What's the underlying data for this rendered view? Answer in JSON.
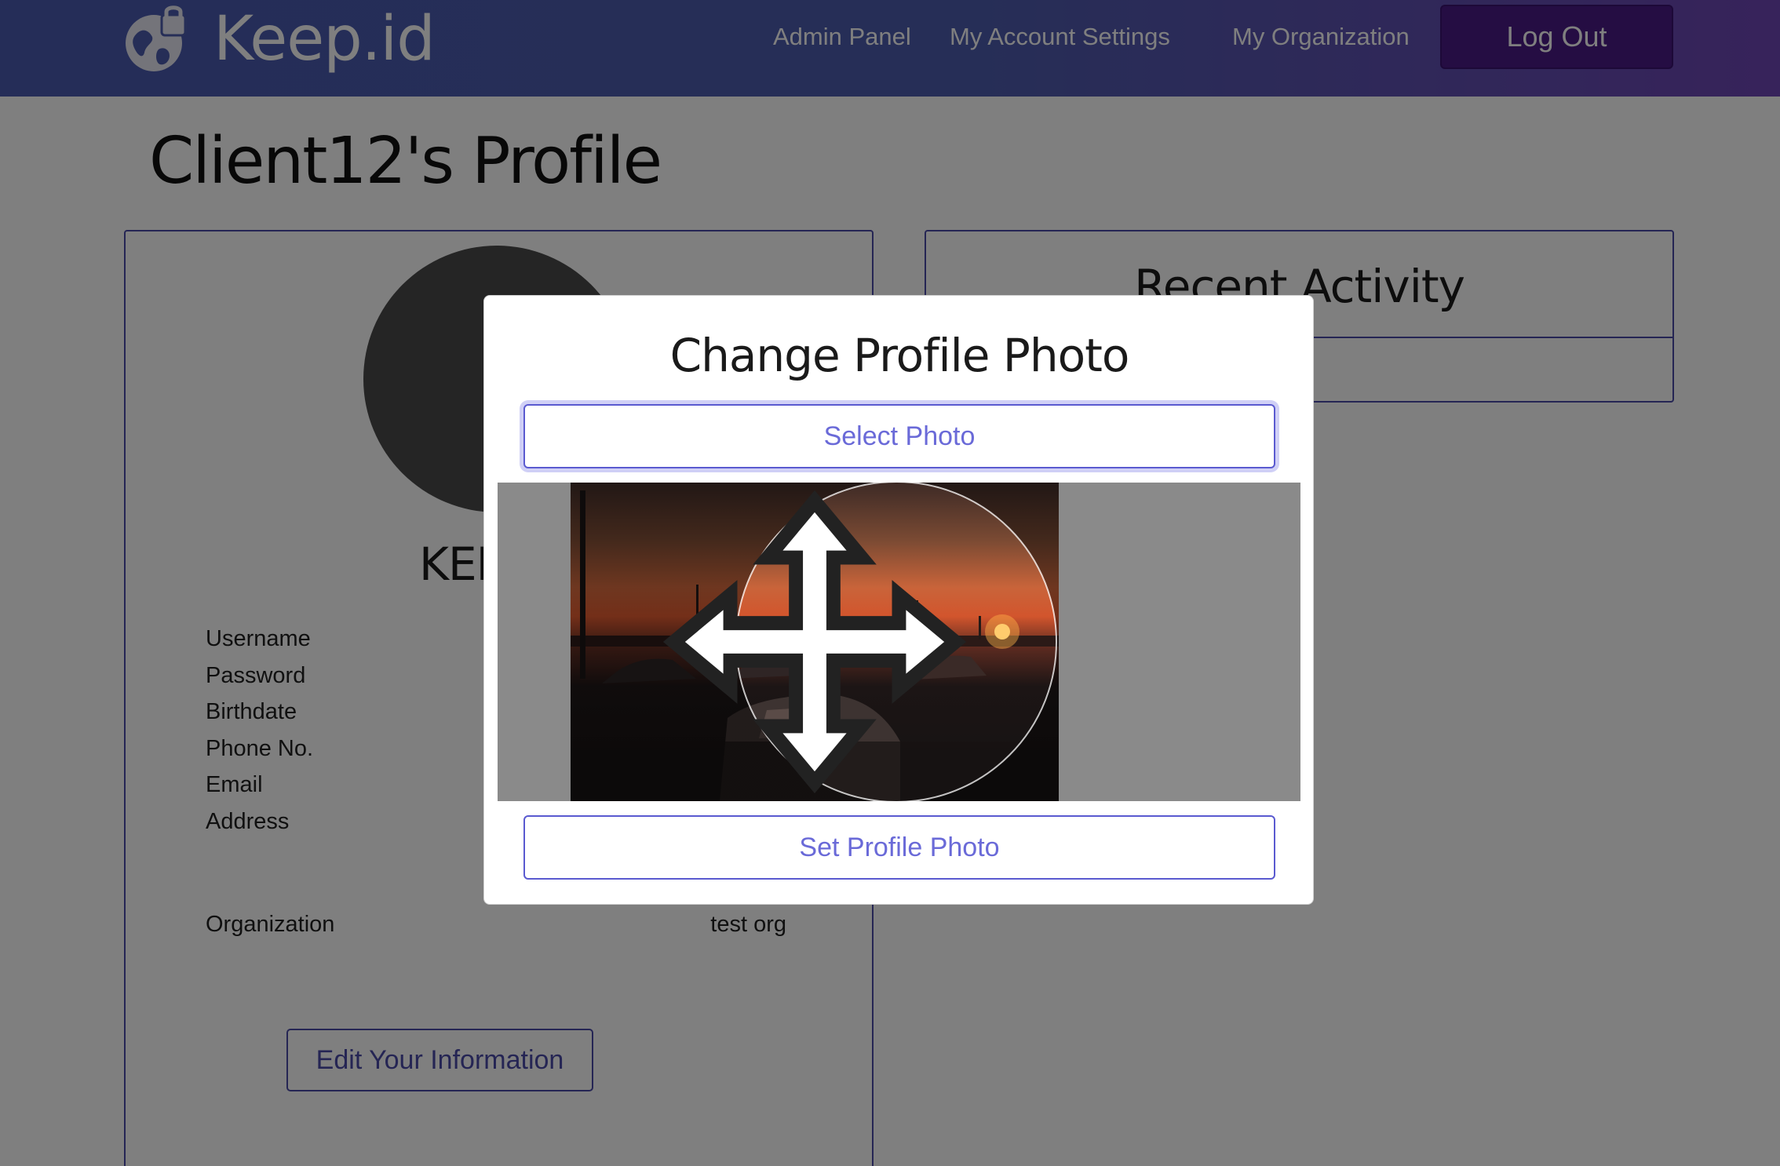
{
  "header": {
    "brand": "Keep.id",
    "nav": [
      {
        "label": "Admin Panel"
      },
      {
        "label": "My Account Settings"
      },
      {
        "label": "My Organization"
      }
    ],
    "logout_label": "Log Out"
  },
  "page": {
    "title": "Client12's Profile"
  },
  "profile": {
    "name": "KEEPID",
    "fields": [
      "Username",
      "Password",
      "Birthdate",
      "Phone No.",
      "Email",
      "Address"
    ],
    "organization_label": "Organization",
    "organization_value": "test org",
    "edit_label": "Edit Your Information"
  },
  "activity": {
    "title": "Recent Activity"
  },
  "modal": {
    "title": "Change Profile Photo",
    "select_label": "Select Photo",
    "set_label": "Set Profile Photo"
  },
  "colors": {
    "accent": "#4b4ba8",
    "header_start": "#4a5bb1",
    "header_end": "#6f46b6",
    "logout": "#4a1a86",
    "button_text": "#6a6ad8"
  },
  "icons": {
    "brand": "globe-lock-icon",
    "crop_handle": "move-icon"
  }
}
